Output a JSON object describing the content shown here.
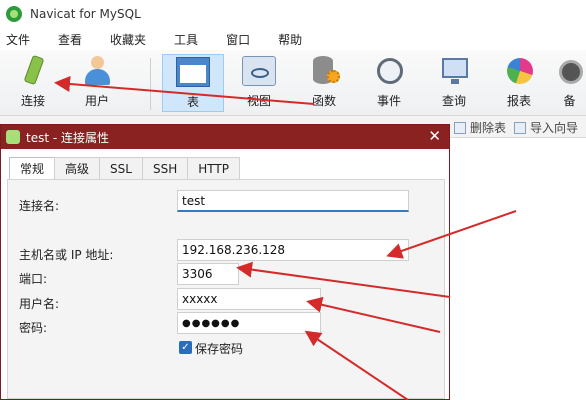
{
  "app": {
    "title": "Navicat for MySQL"
  },
  "menu": [
    "文件",
    "查看",
    "收藏夹",
    "工具",
    "窗口",
    "帮助"
  ],
  "toolbar": {
    "items": [
      {
        "label": "连接",
        "icon": "plug-icon"
      },
      {
        "label": "用户",
        "icon": "user-icon"
      },
      {
        "label": "表",
        "icon": "table-icon"
      },
      {
        "label": "视图",
        "icon": "view-icon"
      },
      {
        "label": "函数",
        "icon": "function-icon"
      },
      {
        "label": "事件",
        "icon": "clock-icon"
      },
      {
        "label": "查询",
        "icon": "query-icon"
      },
      {
        "label": "报表",
        "icon": "report-icon"
      },
      {
        "label": "备",
        "icon": "backup-icon"
      }
    ]
  },
  "subtoolbar": {
    "delete_table": "删除表",
    "import_wizard": "导入向导"
  },
  "dialog": {
    "title": "test - 连接属性",
    "close": "✕",
    "tabs": [
      "常规",
      "高级",
      "SSL",
      "SSH",
      "HTTP"
    ],
    "fields": {
      "connection_name": {
        "label": "连接名:",
        "value": "test"
      },
      "host": {
        "label": "主机名或 IP 地址:",
        "value": "192.168.236.128"
      },
      "port": {
        "label": "端口:",
        "value": "3306"
      },
      "username": {
        "label": "用户名:",
        "value": "xxxxx"
      },
      "password": {
        "label": "密码:",
        "value": "●●●●●●"
      }
    },
    "save_password": {
      "label": "保存密码",
      "checked": true
    }
  },
  "colors": {
    "dialog_title": "#8a2222",
    "annotation_arrow": "#d42a2a",
    "accent": "#3a78c2"
  }
}
